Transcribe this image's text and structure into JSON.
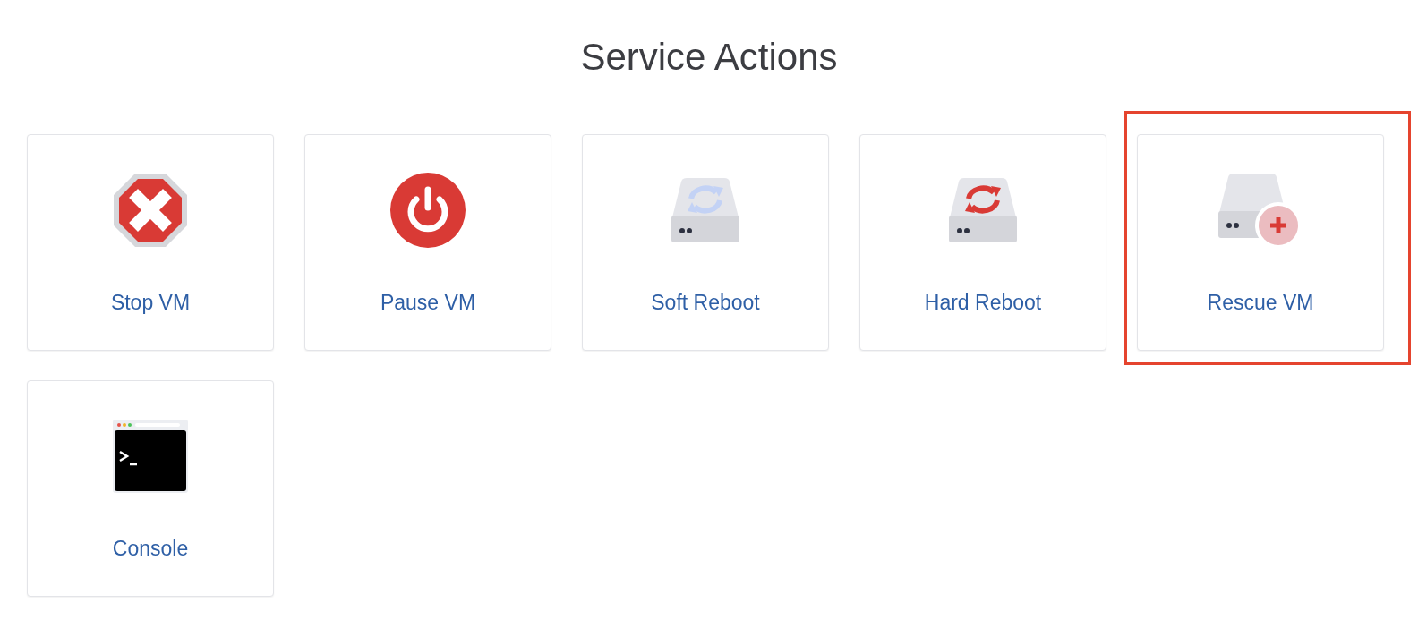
{
  "title": "Service Actions",
  "actions": [
    {
      "label": "Stop VM",
      "kind": "stop",
      "highlighted": false
    },
    {
      "label": "Pause VM",
      "kind": "power",
      "highlighted": false
    },
    {
      "label": "Soft Reboot",
      "kind": "soft-reboot",
      "highlighted": false
    },
    {
      "label": "Hard Reboot",
      "kind": "hard-reboot",
      "highlighted": false
    },
    {
      "label": "Rescue VM",
      "kind": "rescue",
      "highlighted": true
    },
    {
      "label": "Console",
      "kind": "console",
      "highlighted": false
    }
  ]
}
